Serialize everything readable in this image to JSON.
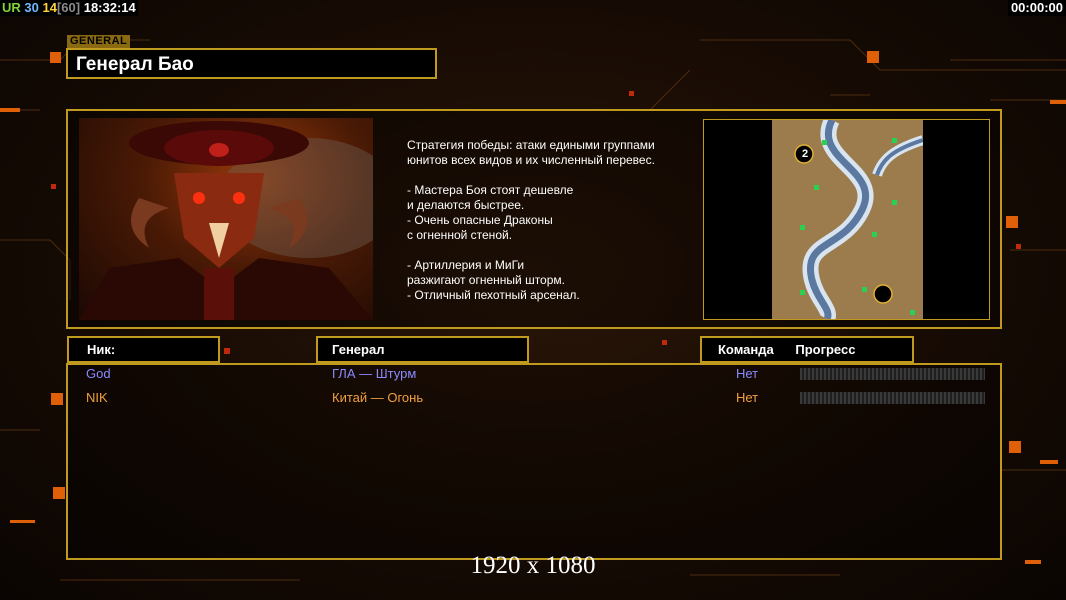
{
  "hud": {
    "ur_label": "UR",
    "fps": "30",
    "ping": "14",
    "fps_limit": "[60]",
    "time": "18:32:14",
    "game_timer": "00:00:00"
  },
  "general": {
    "tag": "GENERAL",
    "name": "Генерал Бао",
    "description": "Стратегия победы: атаки едиными группами\nюнитов всех видов и их численный перевес.\n\n- Мастера Боя стоят дешевле\nи делаются быстрее.\n- Очень опасные Драконы\nс огненной стеной.\n\n- Артиллерия и МиГи\nразжигают огненный шторм.\n- Отличный пехотный арсенал."
  },
  "map": {
    "start_position_label": "2"
  },
  "columns": {
    "nick": "Ник:",
    "general": "Генерал",
    "team": "Команда",
    "progress": "Прогресс"
  },
  "players": [
    {
      "nick": "God",
      "general": "ГЛА — Штурм",
      "team": "Нет",
      "color": "#8a8aff",
      "progress": 0
    },
    {
      "nick": "NIK",
      "general": "Китай — Огонь",
      "team": "Нет",
      "color": "#f0a040",
      "progress": 0
    }
  ],
  "footer": {
    "resolution": "1920 x 1080"
  },
  "colors": {
    "accent_border": "#bf9a1f",
    "background": "#120a05"
  }
}
